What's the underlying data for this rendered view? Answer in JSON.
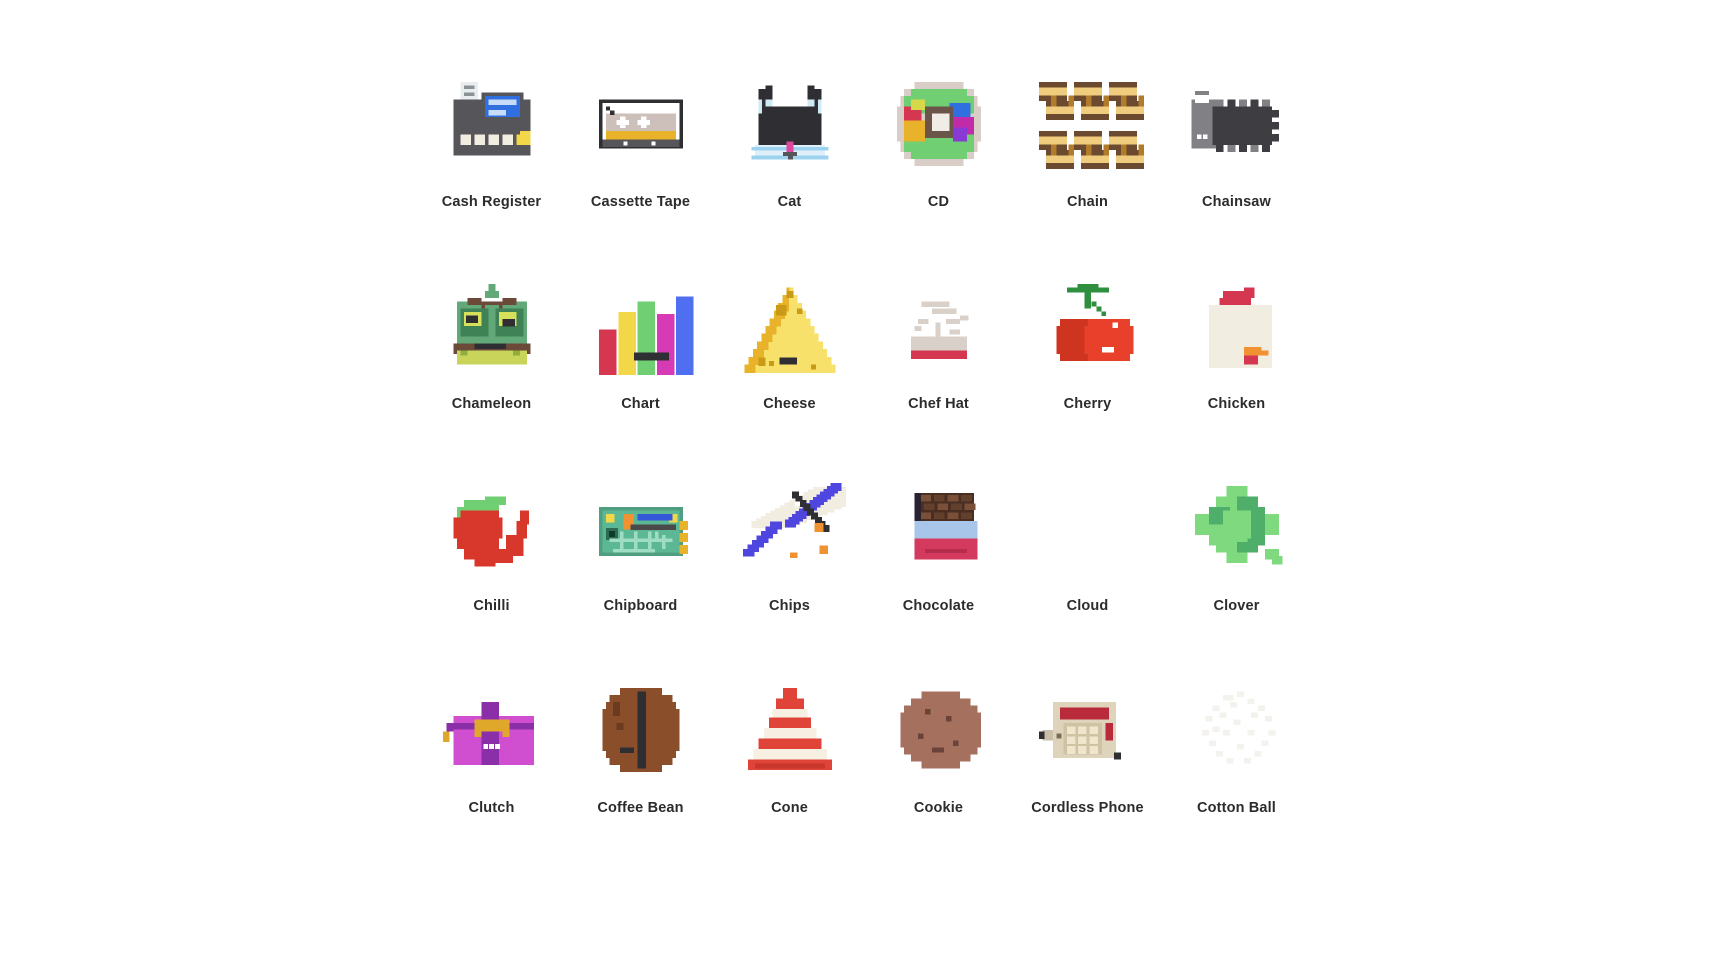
{
  "page": {
    "background": "#ffffff",
    "label_color": "#2c2c2c",
    "columns": 6,
    "rows": 4
  },
  "icons": [
    {
      "label": "Cash Register",
      "name": "cash-register",
      "status": "loaded"
    },
    {
      "label": "Cassette Tape",
      "name": "cassette-tape",
      "status": "loaded"
    },
    {
      "label": "Cat",
      "name": "cat",
      "status": "loaded"
    },
    {
      "label": "CD",
      "name": "cd",
      "status": "loaded"
    },
    {
      "label": "Chain",
      "name": "chain",
      "status": "loaded"
    },
    {
      "label": "Chainsaw",
      "name": "chainsaw",
      "status": "loaded"
    },
    {
      "label": "Chameleon",
      "name": "chameleon",
      "status": "loaded"
    },
    {
      "label": "Chart",
      "name": "chart",
      "status": "loaded"
    },
    {
      "label": "Cheese",
      "name": "cheese",
      "status": "loaded"
    },
    {
      "label": "Chef Hat",
      "name": "chef-hat",
      "status": "loaded"
    },
    {
      "label": "Cherry",
      "name": "cherry",
      "status": "loaded"
    },
    {
      "label": "Chicken",
      "name": "chicken",
      "status": "loaded"
    },
    {
      "label": "Chilli",
      "name": "chilli",
      "status": "loaded"
    },
    {
      "label": "Chipboard",
      "name": "chipboard",
      "status": "loaded"
    },
    {
      "label": "Chips",
      "name": "chips",
      "status": "loaded"
    },
    {
      "label": "Chocolate",
      "name": "chocolate",
      "status": "loaded"
    },
    {
      "label": "Cloud",
      "name": "cloud",
      "status": "missing"
    },
    {
      "label": "Clover",
      "name": "clover",
      "status": "loaded"
    },
    {
      "label": "Clutch",
      "name": "clutch",
      "status": "loaded"
    },
    {
      "label": "Coffee Bean",
      "name": "coffee-bean",
      "status": "loaded"
    },
    {
      "label": "Cone",
      "name": "cone",
      "status": "loaded"
    },
    {
      "label": "Cookie",
      "name": "cookie",
      "status": "loaded"
    },
    {
      "label": "Cordless Phone",
      "name": "cordless-phone",
      "status": "loaded"
    },
    {
      "label": "Cotton Ball",
      "name": "cotton-ball",
      "status": "faded"
    }
  ],
  "palette": {
    "dark_grey": "#55555a",
    "mid_grey": "#808085",
    "near_black": "#2f2f33",
    "blue": "#2f6fe0",
    "cream": "#f2ede1",
    "yellow": "#f2d749",
    "gold": "#e8b22a",
    "red": "#dc3b36",
    "crimson": "#d4374f",
    "green": "#6fcf72",
    "deep_green": "#3f9456",
    "teal_green": "#5aa882",
    "brown": "#6b4226",
    "tan": "#f0cd7e",
    "magenta": "#d63bb5",
    "purple": "#5a4fe0",
    "ice_blue": "#d6ecf7",
    "light_blue": "#a8c6ea",
    "orange": "#f09231",
    "cookie_brown": "#a5705e",
    "bean_brown": "#96522c"
  }
}
